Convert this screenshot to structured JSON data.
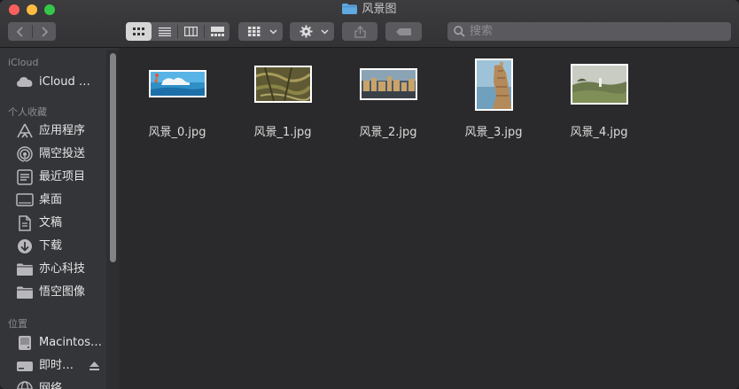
{
  "window": {
    "title": "风景图"
  },
  "toolbar": {
    "search_placeholder": "搜索",
    "icons": [
      "back-icon",
      "forward-icon",
      "icon-view-icon",
      "list-view-icon",
      "column-view-icon",
      "gallery-view-icon",
      "group-icon",
      "gear-icon",
      "share-icon",
      "tag-icon",
      "search-icon"
    ]
  },
  "sidebar": {
    "sections": [
      {
        "title": "iCloud",
        "items": [
          {
            "label": "iCloud …",
            "icon": "cloud-icon"
          }
        ]
      },
      {
        "title": "个人收藏",
        "items": [
          {
            "label": "应用程序",
            "icon": "applications-icon"
          },
          {
            "label": "隔空投送",
            "icon": "airdrop-icon"
          },
          {
            "label": "最近项目",
            "icon": "recents-icon"
          },
          {
            "label": "桌面",
            "icon": "desktop-icon"
          },
          {
            "label": "文稿",
            "icon": "documents-icon"
          },
          {
            "label": "下载",
            "icon": "downloads-icon"
          },
          {
            "label": "亦心科技",
            "icon": "folder-icon"
          },
          {
            "label": "悟空图像",
            "icon": "folder-icon"
          }
        ]
      },
      {
        "title": "位置",
        "items": [
          {
            "label": "Macintos…",
            "icon": "hard-disk-icon"
          },
          {
            "label": "即时…",
            "icon": "disk-icon"
          },
          {
            "label": "网络",
            "icon": "network-icon"
          }
        ]
      }
    ]
  },
  "files": [
    {
      "name": "风景_0.jpg"
    },
    {
      "name": "风景_1.jpg"
    },
    {
      "name": "风景_2.jpg"
    },
    {
      "name": "风景_3.jpg"
    },
    {
      "name": "风景_4.jpg"
    }
  ],
  "colors": {
    "window_bg": "#2b2b2e",
    "sidebar_bg": "#343539",
    "folder_blue": "#5fa8e0"
  }
}
